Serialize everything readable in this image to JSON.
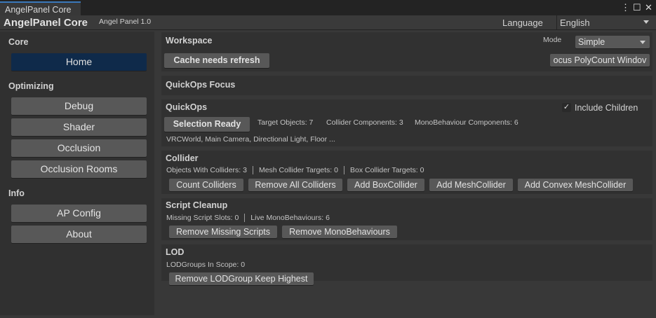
{
  "window": {
    "tab_title": "AngelPanel Core",
    "menu_icon": "⋮",
    "maximize_icon": "☐",
    "close_icon": "✕"
  },
  "header": {
    "title": "AngelPanel Core",
    "version": "Angel Panel 1.0",
    "language_label": "Language",
    "language_value": "English"
  },
  "sidebar": {
    "sections": [
      {
        "label": "Core",
        "items": [
          {
            "label": "Home",
            "active": true
          }
        ]
      },
      {
        "label": "Optimizing",
        "items": [
          {
            "label": "Debug"
          },
          {
            "label": "Shader"
          },
          {
            "label": "Occlusion"
          },
          {
            "label": "Occlusion Rooms"
          }
        ]
      },
      {
        "label": "Info",
        "items": [
          {
            "label": "AP Config"
          },
          {
            "label": "About"
          }
        ]
      }
    ]
  },
  "workspace": {
    "title": "Workspace",
    "mode_label": "Mode",
    "mode_value": "Simple",
    "cache_button": "Cache needs refresh",
    "focus_button": "ocus PolyCount Windov"
  },
  "quickops_focus": {
    "title": "QuickOps Focus"
  },
  "quickops": {
    "title": "QuickOps",
    "include_children": "Include Children",
    "include_children_checked": true,
    "selection_button": "Selection Ready",
    "target_objects": "Target Objects: 7",
    "collider_components": "Collider Components: 3",
    "mono_components": "MonoBehaviour Components: 6",
    "selection_list": "VRCWorld, Main Camera, Directional Light, Floor ..."
  },
  "collider": {
    "title": "Collider",
    "stats": [
      "Objects With Colliders: 3",
      "Mesh Collider Targets: 0",
      "Box Collider Targets: 0"
    ],
    "buttons": [
      "Count Colliders",
      "Remove All Colliders",
      "Add BoxCollider",
      "Add MeshCollider",
      "Add Convex MeshCollider"
    ]
  },
  "script_cleanup": {
    "title": "Script Cleanup",
    "stats": [
      "Missing Script Slots: 0",
      "Live MonoBehaviours: 6"
    ],
    "buttons": [
      "Remove Missing Scripts",
      "Remove MonoBehaviours"
    ]
  },
  "lod": {
    "title": "LOD",
    "stats": [
      "LODGroups In Scope: 0"
    ],
    "buttons": [
      "Remove LODGroup Keep Highest"
    ]
  }
}
